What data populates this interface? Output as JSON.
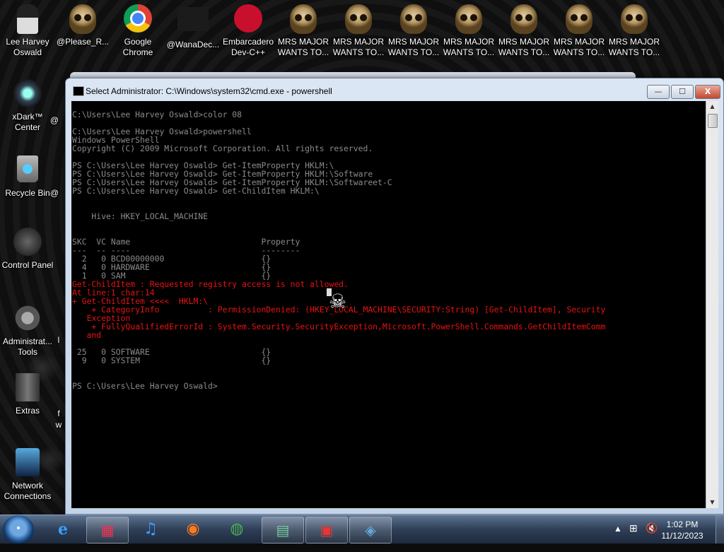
{
  "desktop": {
    "top_icons": [
      {
        "label_lines": [
          "Lee Harvey",
          "Oswald"
        ],
        "icon": "person-icon"
      },
      {
        "label_lines": [
          "@Please_R..."
        ],
        "icon": "skull-icon"
      },
      {
        "label_lines": [
          "Google",
          "Chrome"
        ],
        "icon": "chrome-icon"
      },
      {
        "label_lines": [
          "@WanaDec..."
        ],
        "icon": "blank-icon"
      },
      {
        "label_lines": [
          "Embarcadero",
          "Dev-C++"
        ],
        "icon": "devcpp-icon"
      },
      {
        "label_lines": [
          "MRS MAJOR",
          "WANTS TO..."
        ],
        "icon": "skull-icon"
      },
      {
        "label_lines": [
          "MRS MAJOR",
          "WANTS TO..."
        ],
        "icon": "skull-icon"
      },
      {
        "label_lines": [
          "MRS MAJOR",
          "WANTS TO..."
        ],
        "icon": "skull-icon"
      },
      {
        "label_lines": [
          "MRS MAJOR",
          "WANTS TO..."
        ],
        "icon": "skull-icon"
      },
      {
        "label_lines": [
          "MRS MAJOR",
          "WANTS TO..."
        ],
        "icon": "skull-icon"
      },
      {
        "label_lines": [
          "MRS MAJOR",
          "WANTS TO..."
        ],
        "icon": "skull-icon"
      },
      {
        "label_lines": [
          "MRS MAJOR",
          "WANTS TO..."
        ],
        "icon": "skull-icon"
      }
    ],
    "left_icons": [
      {
        "label_lines": [
          "xDark™",
          "Center"
        ],
        "icon": "xdark-icon"
      },
      {
        "label_lines": [
          "Recycle Bin"
        ],
        "icon": "recycle-bin-icon"
      },
      {
        "label_lines": [
          "Control Panel"
        ],
        "icon": "control-panel-icon"
      },
      {
        "label_lines": [
          "Administrat...",
          "Tools"
        ],
        "icon": "admin-tools-icon"
      },
      {
        "label_lines": [
          "Extras"
        ],
        "icon": "folder-icon"
      },
      {
        "label_lines": [
          "Network",
          "Connections"
        ],
        "icon": "network-icon"
      }
    ],
    "partial_labels": [
      "@",
      "@",
      "f",
      "w",
      "l"
    ]
  },
  "window": {
    "title": "Select Administrator: C:\\Windows\\system32\\cmd.exe - powershell",
    "minimize": "—",
    "maximize": "☐",
    "close": "X"
  },
  "console": {
    "lines": [
      {
        "text": "C:\\Users\\Lee Harvey Oswald>color 08",
        "color": "gray"
      },
      {
        "text": "",
        "color": "gray"
      },
      {
        "text": "C:\\Users\\Lee Harvey Oswald>powershell",
        "color": "gray"
      },
      {
        "text": "Windows PowerShell",
        "color": "gray"
      },
      {
        "text": "Copyright (C) 2009 Microsoft Corporation. All rights reserved.",
        "color": "gray"
      },
      {
        "text": "",
        "color": "gray"
      },
      {
        "text": "PS C:\\Users\\Lee Harvey Oswald> Get-ItemProperty HKLM:\\",
        "color": "gray"
      },
      {
        "text": "PS C:\\Users\\Lee Harvey Oswald> Get-ItemProperty HKLM:\\Software",
        "color": "gray"
      },
      {
        "text": "PS C:\\Users\\Lee Harvey Oswald> Get-ItemProperty HKLM:\\Softwareet-C",
        "color": "gray"
      },
      {
        "text": "PS C:\\Users\\Lee Harvey Oswald> Get-ChildItem HKLM:\\",
        "color": "gray"
      },
      {
        "text": "",
        "color": "gray"
      },
      {
        "text": "",
        "color": "gray"
      },
      {
        "text": "    Hive: HKEY_LOCAL_MACHINE",
        "color": "gray"
      },
      {
        "text": "",
        "color": "gray"
      },
      {
        "text": "",
        "color": "gray"
      },
      {
        "text": "SKC  VC Name                           Property",
        "color": "gray"
      },
      {
        "text": "---  -- ----                           --------",
        "color": "gray"
      },
      {
        "text": "  2   0 BCD00000000                    {}",
        "color": "gray"
      },
      {
        "text": "  4   0 HARDWARE                       {}",
        "color": "gray"
      },
      {
        "text": "  1   0 SAM                            {}",
        "color": "gray"
      },
      {
        "text": "Get-ChildItem : Requested registry access is not allowed.",
        "color": "red"
      },
      {
        "text": "At line:1 char:14",
        "color": "red"
      },
      {
        "text": "+ Get-ChildItem <<<<  HKLM:\\",
        "color": "red"
      },
      {
        "text": "    + CategoryInfo          : PermissionDenied: (HKEY_LOCAL_MACHINE\\SECURITY:String) [Get-ChildItem], Security",
        "color": "red"
      },
      {
        "text": "   Exception",
        "color": "red"
      },
      {
        "text": "    + FullyQualifiedErrorId : System.Security.SecurityException,Microsoft.PowerShell.Commands.GetChildItemComm",
        "color": "red"
      },
      {
        "text": "   and",
        "color": "red"
      },
      {
        "text": "",
        "color": "gray"
      },
      {
        "text": " 25   0 SOFTWARE                       {}",
        "color": "gray"
      },
      {
        "text": "  9   0 SYSTEM                         {}",
        "color": "gray"
      },
      {
        "text": "",
        "color": "gray"
      },
      {
        "text": "",
        "color": "gray"
      },
      {
        "text": "PS C:\\Users\\Lee Harvey Oswald>",
        "color": "gray"
      }
    ],
    "text_color": "#8a8a8a",
    "error_color": "#e81212",
    "background": "#000000"
  },
  "taskbar": {
    "items": [
      {
        "icon": "internet-explorer-icon",
        "glyph": "e"
      },
      {
        "icon": "store-icon",
        "glyph": "▦"
      },
      {
        "icon": "music-player-icon",
        "glyph": "♫"
      },
      {
        "icon": "firefox-icon",
        "glyph": "◉"
      },
      {
        "icon": "chrome-icon",
        "glyph": "◍"
      },
      {
        "icon": "task-manager-icon",
        "glyph": "▤"
      },
      {
        "icon": "toolbox-icon",
        "glyph": "▣"
      },
      {
        "icon": "network-icon",
        "glyph": "◈"
      }
    ],
    "tray_arrow": "▲",
    "time": "1:02 PM",
    "date": "11/12/2023"
  }
}
